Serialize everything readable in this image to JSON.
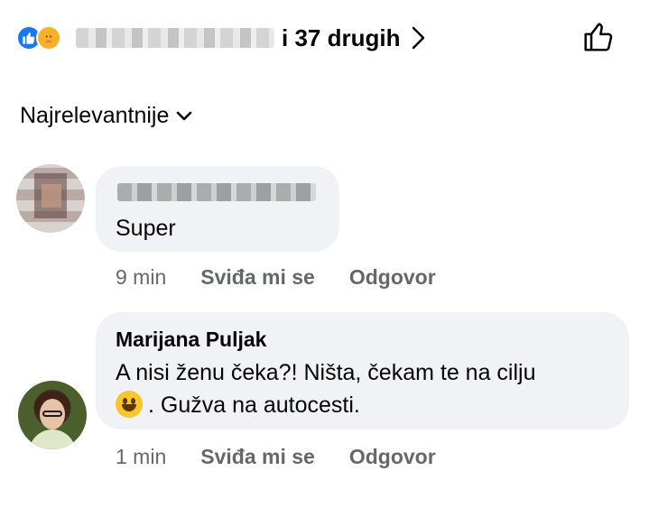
{
  "reactions": {
    "others_text": "i 37 drugih"
  },
  "sort": {
    "label": "Najrelevantnije"
  },
  "comments": [
    {
      "author": "",
      "text": "Super",
      "time": "9 min",
      "like_label": "Sviđa mi se",
      "reply_label": "Odgovor"
    },
    {
      "author": "Marijana Puljak",
      "text_line1": "A nisi ženu čeka?! Ništa, čekam te na cilju",
      "text_line2": ". Gužva na autocesti.",
      "time": "1 min",
      "like_label": "Sviđa mi se",
      "reply_label": "Odgovor"
    }
  ],
  "colors": {
    "like_blue": "#1877f2",
    "care_yellow": "#f7b125",
    "bubble_bg": "#f0f2f5",
    "meta_gray": "#65676b"
  },
  "icons": [
    "like-reaction-icon",
    "care-reaction-icon",
    "chevron-right-icon",
    "thumbs-up-icon",
    "chevron-down-icon",
    "grinning-emoji-icon"
  ]
}
